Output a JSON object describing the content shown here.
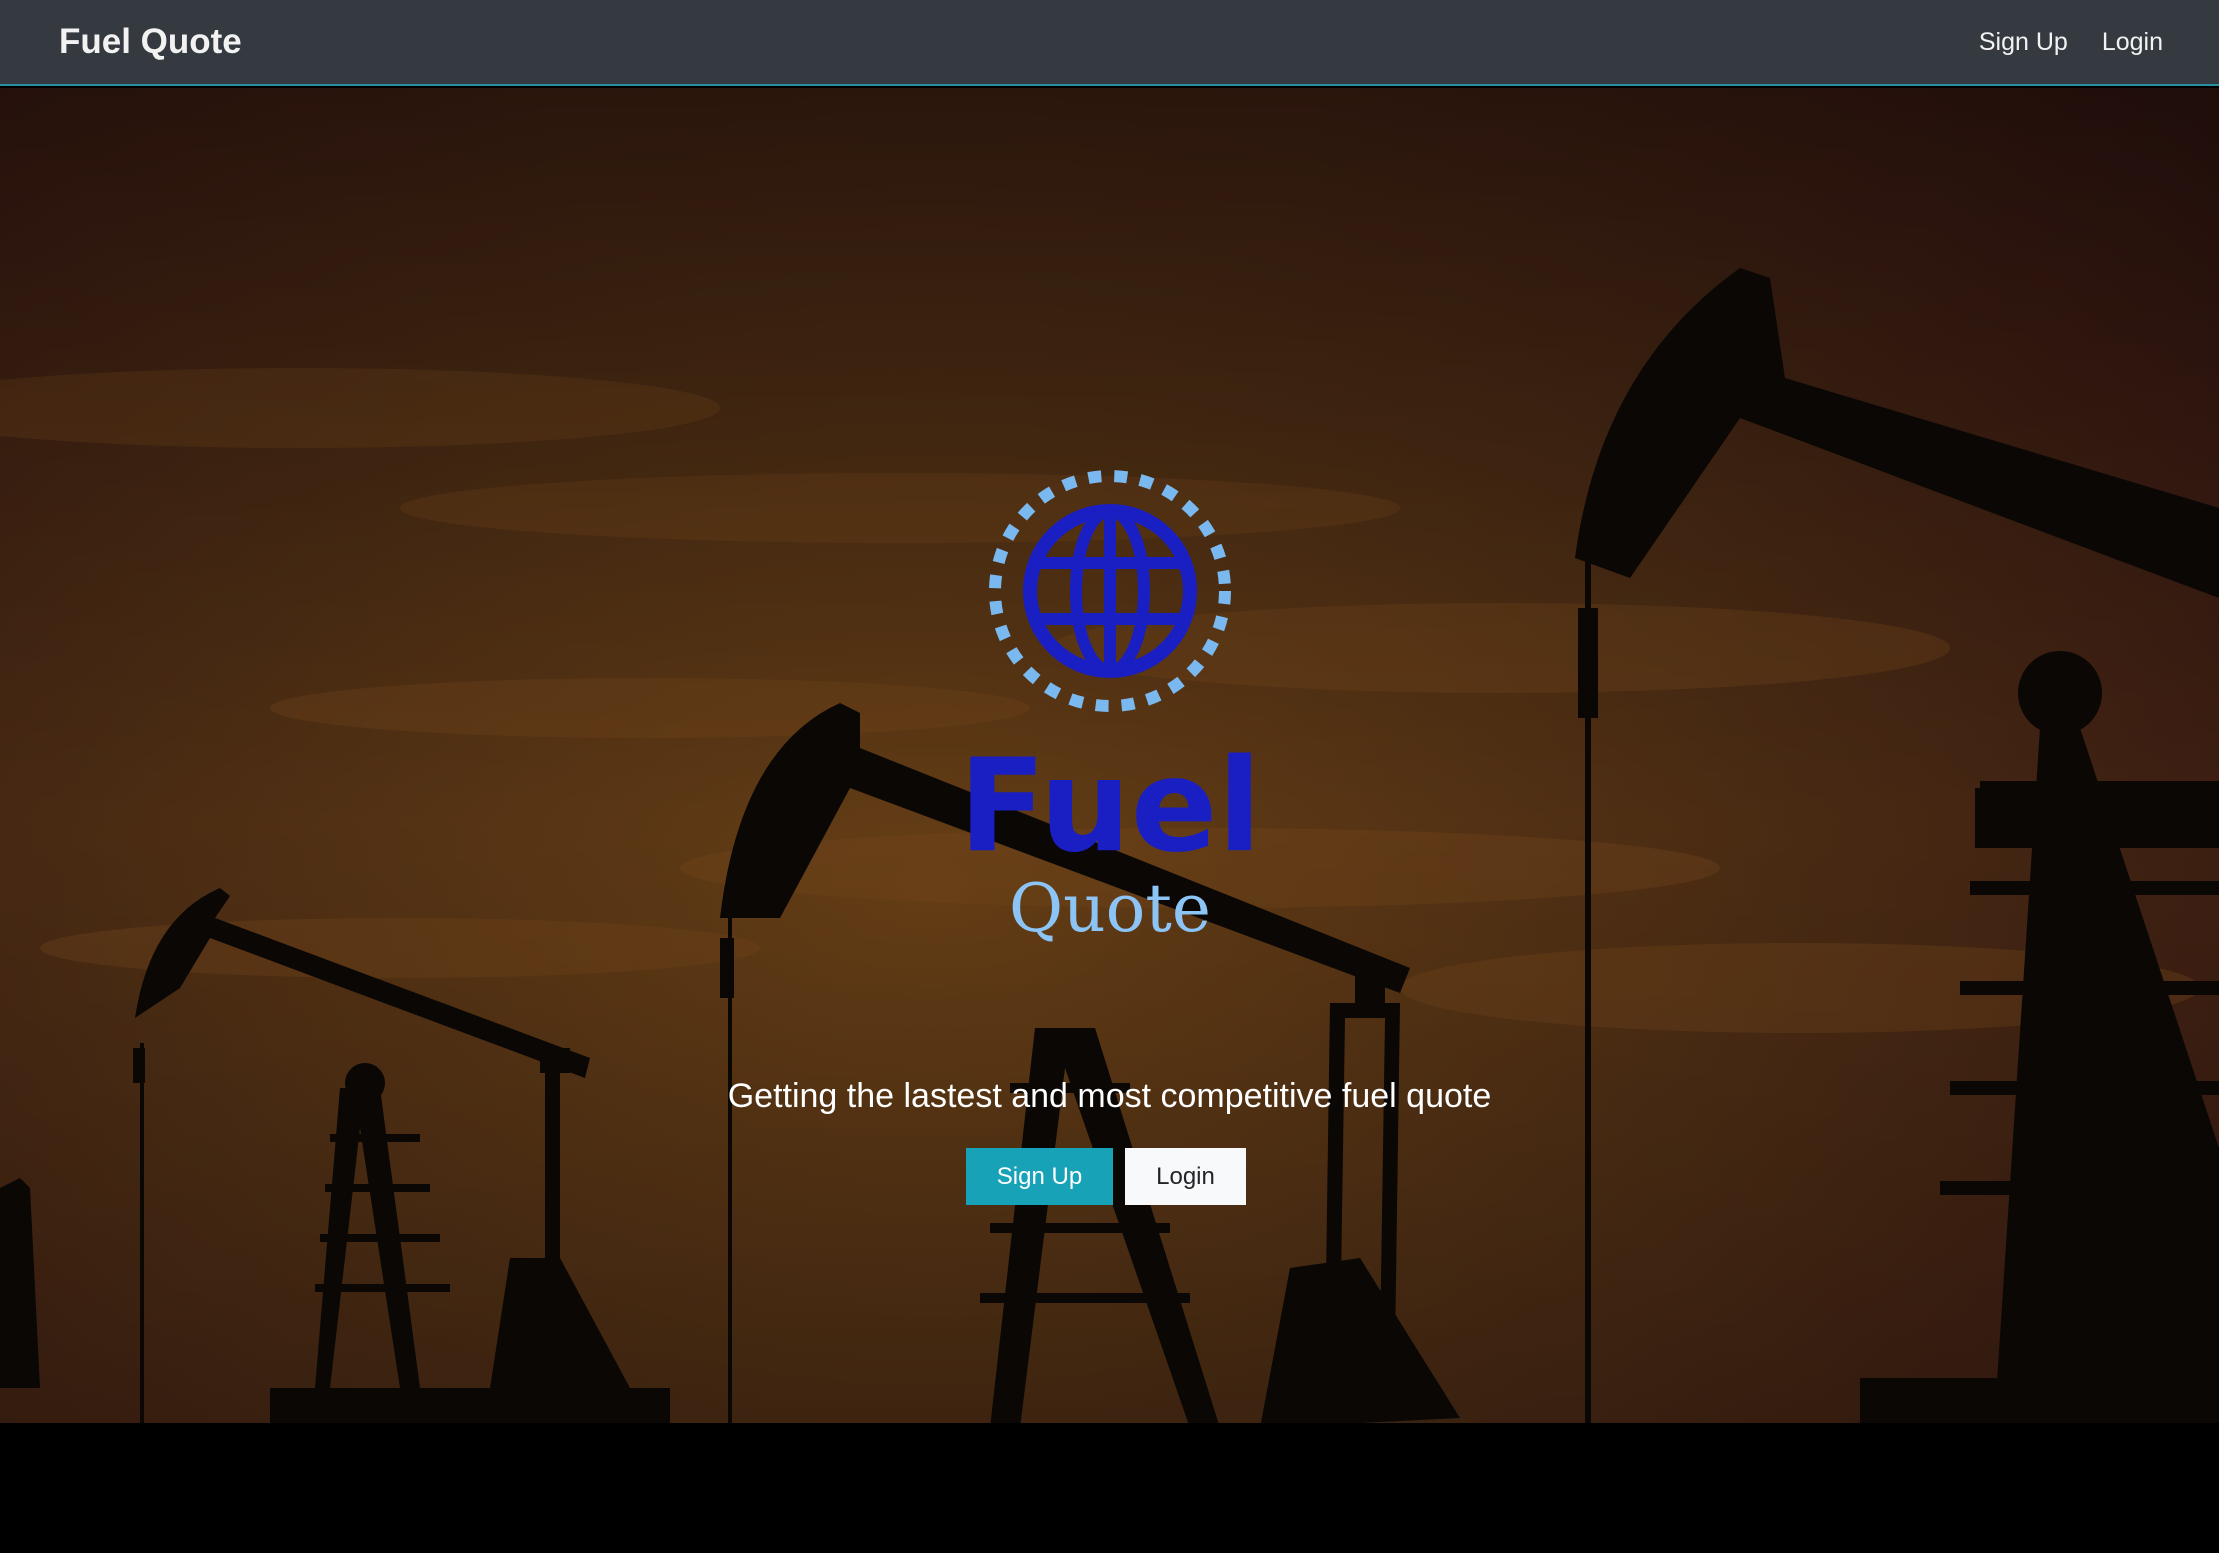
{
  "navbar": {
    "brand": "Fuel Quote",
    "links": [
      "Sign Up",
      "Login"
    ]
  },
  "hero": {
    "logo": {
      "word1": "Fuel",
      "word2": "Quote",
      "icon": "globe-icon"
    },
    "tagline": "Getting the lastest and most competitive fuel quote",
    "signup_label": "Sign Up",
    "login_label": "Login"
  },
  "colors": {
    "navbar_bg": "#343a40",
    "accent": "#17a2b8",
    "logo_primary": "#1a1fc4",
    "logo_secondary": "#7ab8f0"
  }
}
